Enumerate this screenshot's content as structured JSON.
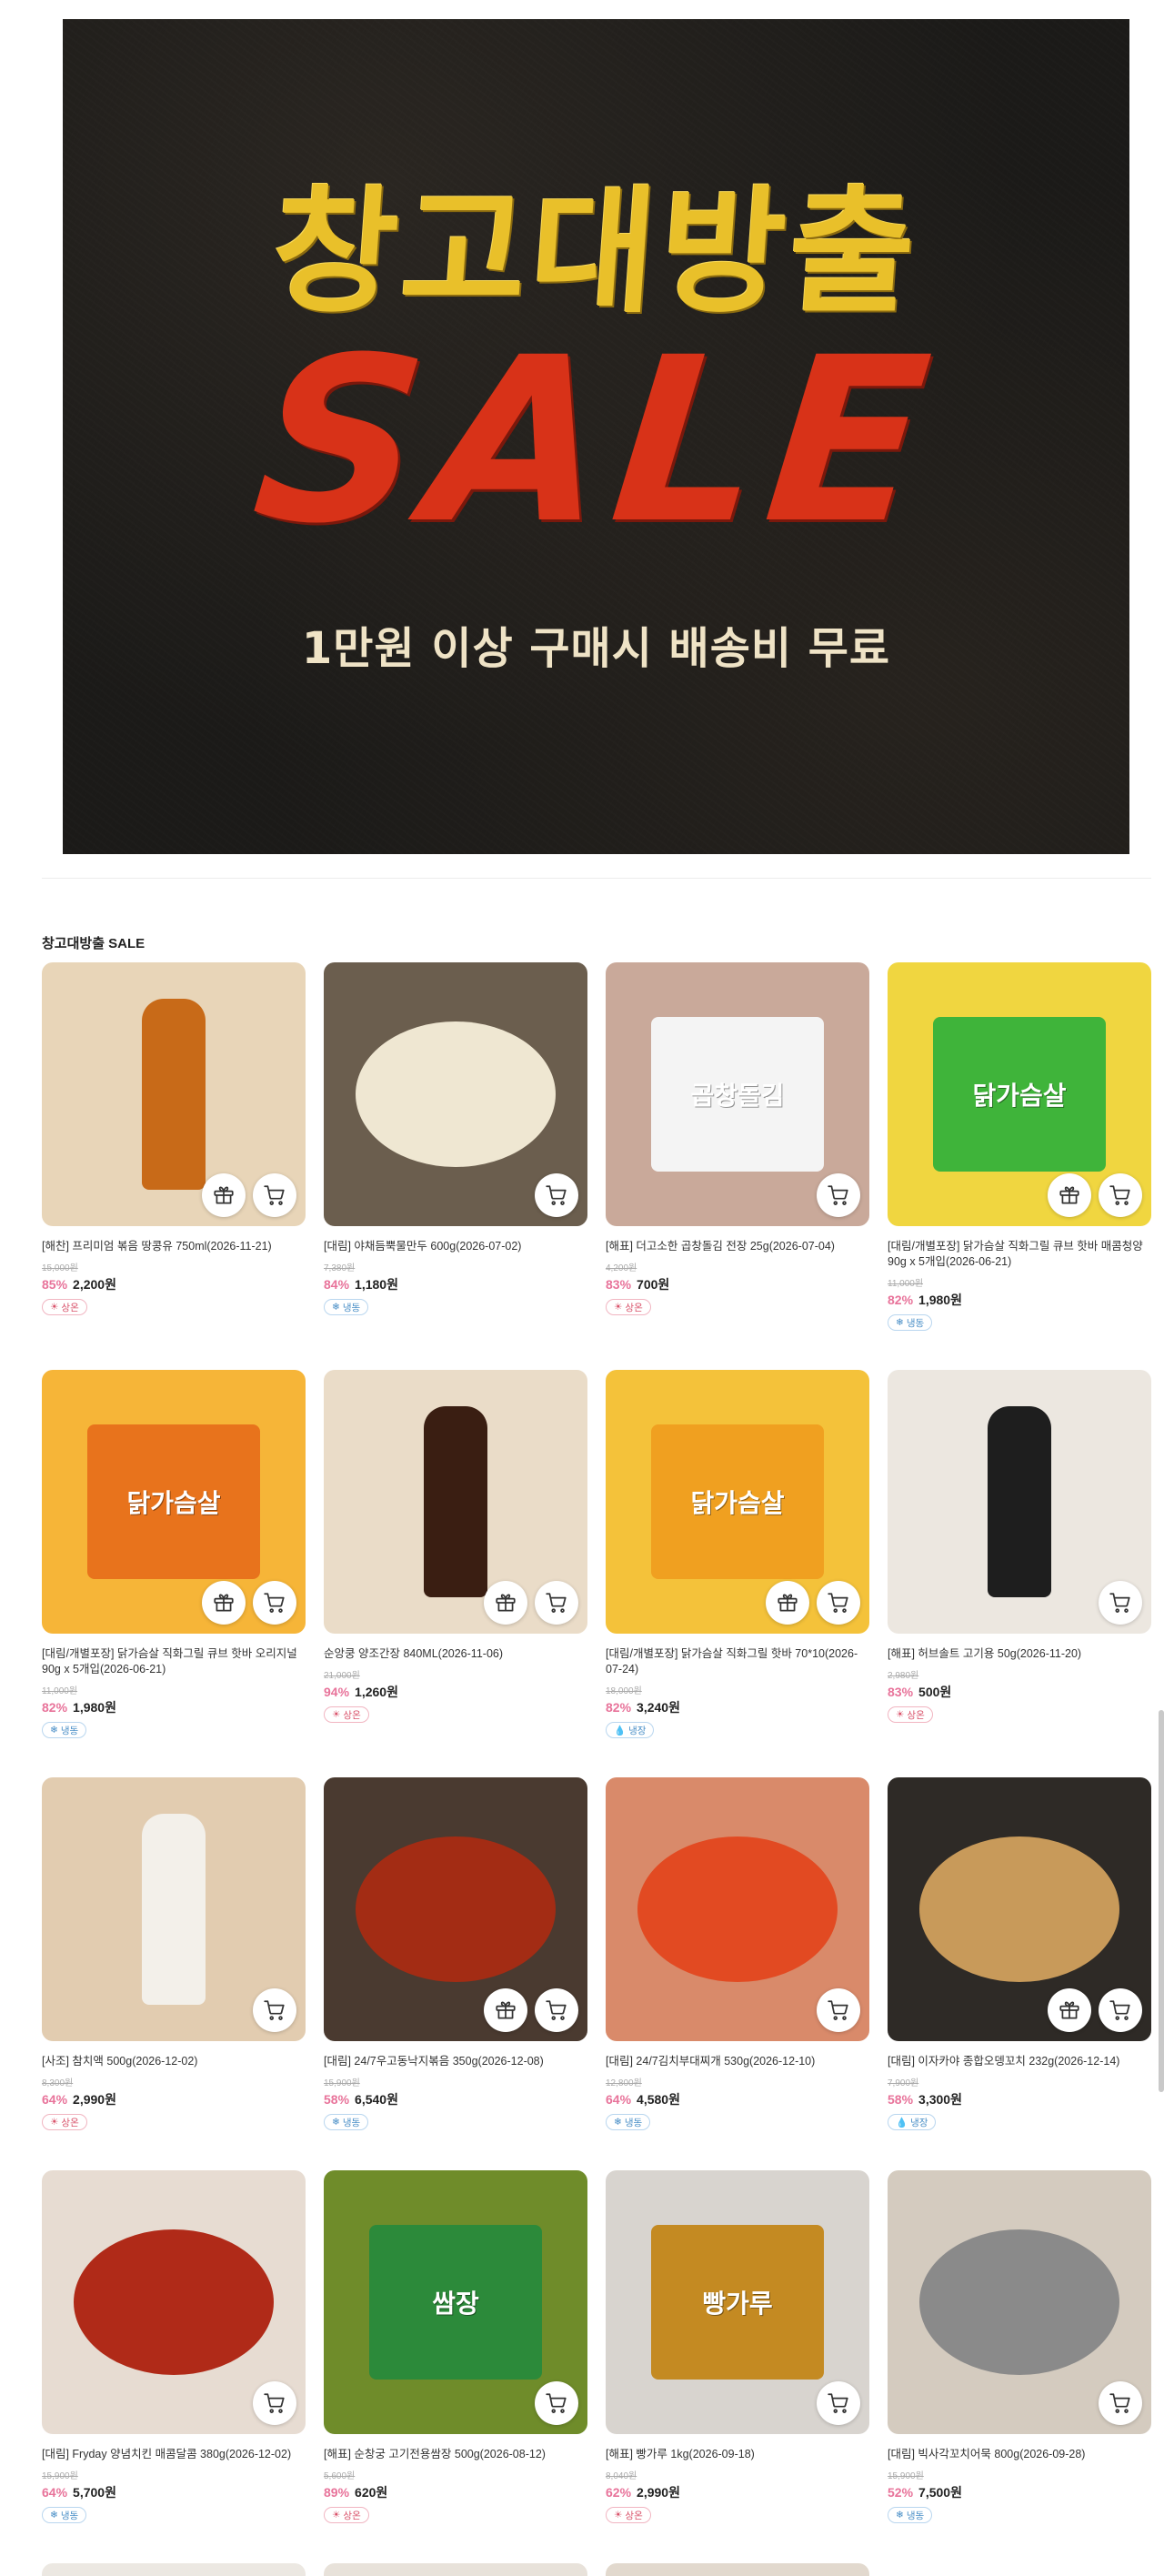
{
  "banner": {
    "line1": "창고대방출",
    "line2": "SALE",
    "line3": "1만원 이상 구매시 배송비 무료"
  },
  "section": {
    "title": "창고대방출 SALE"
  },
  "icons": {
    "gift": "gift-icon",
    "cart": "cart-icon",
    "room_temp": "sun-icon",
    "frozen": "snowflake-icon",
    "refrigerated": "droplet-icon"
  },
  "colors": {
    "discount": "#e8739a",
    "room": "#d9536b",
    "frozen": "#4a8fc7",
    "banner_yellow": "#e9c02a",
    "banner_red": "#d83218"
  },
  "products": [
    {
      "name": "[해찬] 프리미엄 볶음 땅콩유 750ml(2026-11-21)",
      "original": "15,000원",
      "discount": "85%",
      "price": "2,200원",
      "storage": "상온",
      "gift": true,
      "bg": "#e8d5b8",
      "shape": "bottle",
      "color": "#c86a18",
      "label": ""
    },
    {
      "name": "[대림] 야채듬뿍물만두 600g(2026-07-02)",
      "original": "7,380원",
      "discount": "84%",
      "price": "1,180원",
      "storage": "냉동",
      "gift": false,
      "bg": "#6b5e4e",
      "shape": "bowl",
      "color": "#efe7d2",
      "label": ""
    },
    {
      "name": "[해표] 더고소한 곱창돌김 전장 25g(2026-07-04)",
      "original": "4,200원",
      "discount": "83%",
      "price": "700원",
      "storage": "상온",
      "gift": false,
      "bg": "#c9a99a",
      "shape": "pack",
      "color": "#f4f4f4",
      "label": "곱창돌김"
    },
    {
      "name": "[대림/개별포장] 닭가슴살 직화그릴 큐브 핫바 매콤청양 90g x 5개입(2026-06-21)",
      "original": "11,000원",
      "discount": "82%",
      "price": "1,980원",
      "storage": "냉동",
      "gift": true,
      "bg": "#f0d640",
      "shape": "pack",
      "color": "#3fb43a",
      "label": "닭가슴살"
    },
    {
      "name": "[대림/개별포장] 닭가슴살 직화그릴 큐브 핫바 오리지널 90g x 5개입(2026-06-21)",
      "original": "11,000원",
      "discount": "82%",
      "price": "1,980원",
      "storage": "냉동",
      "gift": true,
      "bg": "#f6b538",
      "shape": "pack",
      "color": "#e8731c",
      "label": "닭가슴살"
    },
    {
      "name": "순앙쿵 양조간장 840ML(2026-11-06)",
      "original": "21,000원",
      "discount": "94%",
      "price": "1,260원",
      "storage": "상온",
      "gift": true,
      "bg": "#eadcc8",
      "shape": "bottle",
      "color": "#3a1e12",
      "label": ""
    },
    {
      "name": "[대림/개별포장] 닭가슴살 직화그릴 핫바 70*10(2026-07-24)",
      "original": "18,000원",
      "discount": "82%",
      "price": "3,240원",
      "storage": "냉장",
      "gift": true,
      "bg": "#f4c23a",
      "shape": "pack",
      "color": "#f0a020",
      "label": "닭가슴살"
    },
    {
      "name": "[해표] 허브솔트 고기용 50g(2026-11-20)",
      "original": "2,980원",
      "discount": "83%",
      "price": "500원",
      "storage": "상온",
      "gift": false,
      "bg": "#ece7e0",
      "shape": "bottle",
      "color": "#1e1e1e",
      "label": ""
    },
    {
      "name": "[사조] 참치액 500g(2026-12-02)",
      "original": "8,300원",
      "discount": "64%",
      "price": "2,990원",
      "storage": "상온",
      "gift": false,
      "bg": "#e2ccb0",
      "shape": "bottle",
      "color": "#f3f0ea",
      "label": ""
    },
    {
      "name": "[대림] 24/7우고동낙지볶음 350g(2026-12-08)",
      "original": "15,900원",
      "discount": "58%",
      "price": "6,540원",
      "storage": "냉동",
      "gift": true,
      "bg": "#4a3a30",
      "shape": "bowl",
      "color": "#a32c14",
      "label": ""
    },
    {
      "name": "[대림] 24/7김치부대찌개 530g(2026-12-10)",
      "original": "12,800원",
      "discount": "64%",
      "price": "4,580원",
      "storage": "냉동",
      "gift": false,
      "bg": "#d98a6a",
      "shape": "bowl",
      "color": "#e24a22",
      "label": ""
    },
    {
      "name": "[대림] 이자카야 종합오뎅꼬치 232g(2026-12-14)",
      "original": "7,900원",
      "discount": "58%",
      "price": "3,300원",
      "storage": "냉장",
      "gift": true,
      "bg": "#2e2a26",
      "shape": "bowl",
      "color": "#c89a5a",
      "label": ""
    },
    {
      "name": "[대림] Fryday 양념치킨 매콤달콤 380g(2026-12-02)",
      "original": "15,900원",
      "discount": "64%",
      "price": "5,700원",
      "storage": "냉동",
      "gift": false,
      "bg": "#e7dcd2",
      "shape": "bowl",
      "color": "#b02a18",
      "label": ""
    },
    {
      "name": "[해표] 순창궁 고기전용쌈장 500g(2026-08-12)",
      "original": "5,600원",
      "discount": "89%",
      "price": "620원",
      "storage": "상온",
      "gift": false,
      "bg": "#6f8c2a",
      "shape": "pack",
      "color": "#2c8a3a",
      "label": "쌈장"
    },
    {
      "name": "[해표] 빵가루 1kg(2026-09-18)",
      "original": "8,040원",
      "discount": "62%",
      "price": "2,990원",
      "storage": "상온",
      "gift": false,
      "bg": "#d8d4cf",
      "shape": "pack",
      "color": "#c48a22",
      "label": "빵가루"
    },
    {
      "name": "[대림] 빅사각꼬치어묵 800g(2026-09-28)",
      "original": "15,900원",
      "discount": "52%",
      "price": "7,500원",
      "storage": "냉동",
      "gift": false,
      "bg": "#d4cbbf",
      "shape": "bowl",
      "color": "#8a8a8a",
      "label": ""
    }
  ]
}
